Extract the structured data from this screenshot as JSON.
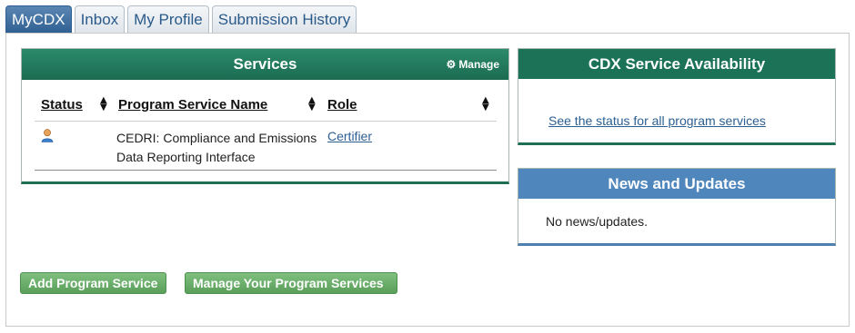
{
  "tabs": [
    {
      "label": "MyCDX",
      "active": true
    },
    {
      "label": "Inbox",
      "active": false
    },
    {
      "label": "My Profile",
      "active": false
    },
    {
      "label": "Submission History",
      "active": false
    }
  ],
  "services": {
    "title": "Services",
    "manage_label": "Manage",
    "columns": {
      "status": "Status",
      "name": "Program Service Name",
      "role": "Role"
    },
    "rows": [
      {
        "status_icon": "user-icon",
        "name": "CEDRI: Compliance and Emissions Data Reporting Interface",
        "role": "Certifier"
      }
    ]
  },
  "availability": {
    "title": "CDX Service Availability",
    "link_label": "See the status for all program services"
  },
  "news": {
    "title": "News and Updates",
    "text": "No news/updates."
  },
  "buttons": {
    "add_label": "Add Program Service",
    "manage_label": "Manage Your Program Services"
  },
  "colors": {
    "services_header": "#1b6b51",
    "news_header": "#4f86bc",
    "active_tab": "#2f5f92",
    "button_green": "#5a9f5a",
    "link": "#2b5f92"
  }
}
